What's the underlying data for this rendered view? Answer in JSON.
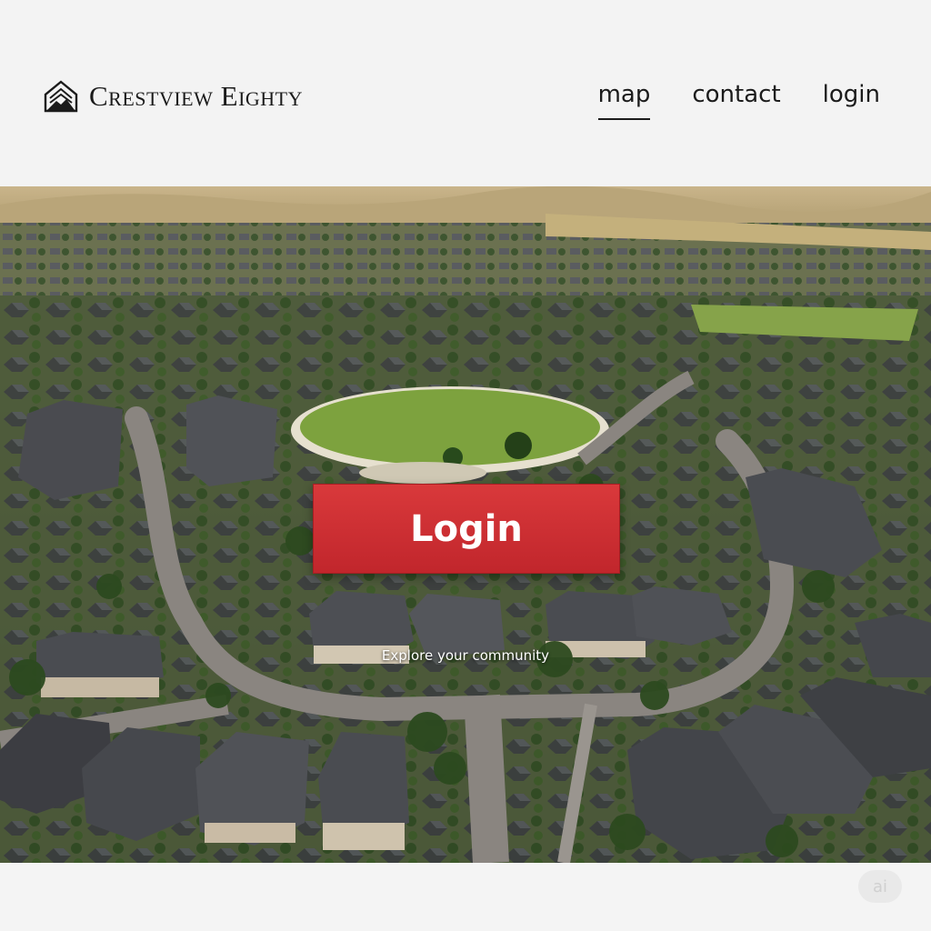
{
  "header": {
    "brand_name": "Crestview Eighty",
    "logo_icon": "mountain-house-logo",
    "nav": [
      {
        "label": "map",
        "active": true
      },
      {
        "label": "contact",
        "active": false
      },
      {
        "label": "login",
        "active": false
      }
    ]
  },
  "hero": {
    "image": "aerial view of suburban neighborhood with central park",
    "cta_label": "Login",
    "tagline": "Explore your community"
  },
  "footer": {
    "badge": "ai"
  },
  "colors": {
    "cta": "#c8282e",
    "text": "#1b1b1b",
    "background": "#f4f4f4"
  }
}
